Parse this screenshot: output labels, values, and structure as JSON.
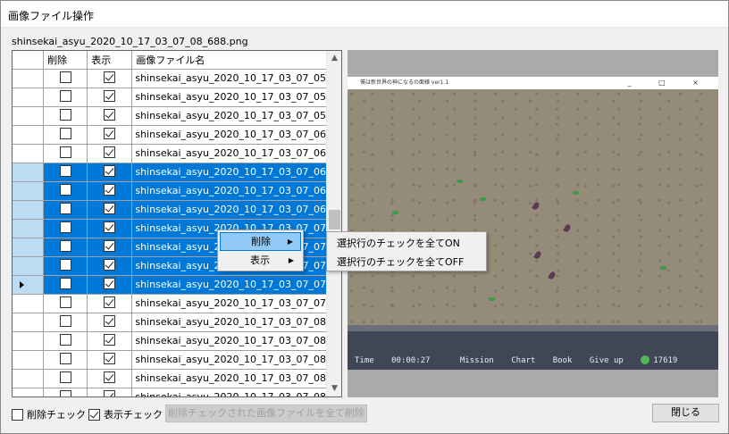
{
  "window": {
    "title": "画像ファイル操作"
  },
  "current_file": "shinsekai_asyu_2020_10_17_03_07_08_688.png",
  "grid": {
    "columns": {
      "delete": "削除",
      "display": "表示",
      "filename": "画像ファイル名"
    },
    "rows": [
      {
        "delete": false,
        "display": true,
        "filename": "shinsekai_asyu_2020_10_17_03_07_05_...",
        "selected": false
      },
      {
        "delete": false,
        "display": true,
        "filename": "shinsekai_asyu_2020_10_17_03_07_05_...",
        "selected": false
      },
      {
        "delete": false,
        "display": true,
        "filename": "shinsekai_asyu_2020_10_17_03_07_05_...",
        "selected": false
      },
      {
        "delete": false,
        "display": true,
        "filename": "shinsekai_asyu_2020_10_17_03_07_06_...",
        "selected": false
      },
      {
        "delete": false,
        "display": true,
        "filename": "shinsekai_asyu_2020_10_17_03_07_06_...",
        "selected": false
      },
      {
        "delete": false,
        "display": true,
        "filename": "shinsekai_asyu_2020_10_17_03_07_06_...",
        "selected": true
      },
      {
        "delete": false,
        "display": true,
        "filename": "shinsekai_asyu_2020_10_17_03_07_06_...",
        "selected": true
      },
      {
        "delete": false,
        "display": true,
        "filename": "shinsekai_asyu_2020_10_17_03_07_06_...",
        "selected": true
      },
      {
        "delete": false,
        "display": true,
        "filename": "shinsekai_asyu_2020_10_17_03_07_07_...",
        "selected": true
      },
      {
        "delete": false,
        "display": true,
        "filename": "shinsekai_asyu_2020_10_17_03_07_07_...",
        "selected": true
      },
      {
        "delete": false,
        "display": true,
        "filename": "shinsekai_asyu_2020_10_17_03_07_07_...",
        "selected": true
      },
      {
        "delete": false,
        "display": true,
        "filename": "shinsekai_asyu_2020_10_17_03_07_07_...",
        "selected": true,
        "current": true
      },
      {
        "delete": false,
        "display": true,
        "filename": "shinsekai_asyu_2020_10_17_03_07_07_...",
        "selected": false
      },
      {
        "delete": false,
        "display": true,
        "filename": "shinsekai_asyu_2020_10_17_03_07_08_...",
        "selected": false
      },
      {
        "delete": false,
        "display": true,
        "filename": "shinsekai_asyu_2020_10_17_03_07_08_...",
        "selected": false
      },
      {
        "delete": false,
        "display": true,
        "filename": "shinsekai_asyu_2020_10_17_03_07_08_...",
        "selected": false
      },
      {
        "delete": false,
        "display": true,
        "filename": "shinsekai_asyu_2020_10_17_03_07_08_...",
        "selected": false
      },
      {
        "delete": false,
        "display": true,
        "filename": "shinsekai_asyu_2020_10_17_03_07_08_...",
        "selected": false
      }
    ]
  },
  "preview": {
    "game_title": "僕は新世界の神になるの面様 ver1.1",
    "window_buttons": "_ □ ×",
    "hud": {
      "time_label": "Time",
      "time_value": "00:00:27",
      "mission": "Mission",
      "chart": "Chart",
      "book": "Book",
      "give_up": "Give up",
      "score": "17619"
    }
  },
  "context_menu": {
    "items": [
      {
        "label": "削除",
        "has_submenu": true,
        "highlighted": true
      },
      {
        "label": "表示",
        "has_submenu": true,
        "highlighted": false
      }
    ],
    "submenu": [
      "選択行のチェックを全てON",
      "選択行のチェックを全てOFF"
    ]
  },
  "bottom": {
    "delete_check_label": "削除チェック",
    "delete_check_checked": false,
    "display_check_label": "表示チェック",
    "display_check_checked": true,
    "delete_all_button": "削除チェックされた画像ファイルを全て削除",
    "close_button": "閉じる"
  },
  "colors": {
    "selection": "#0078d7",
    "selection_header": "#bcdcf4",
    "menu_highlight": "#91c9f7"
  }
}
